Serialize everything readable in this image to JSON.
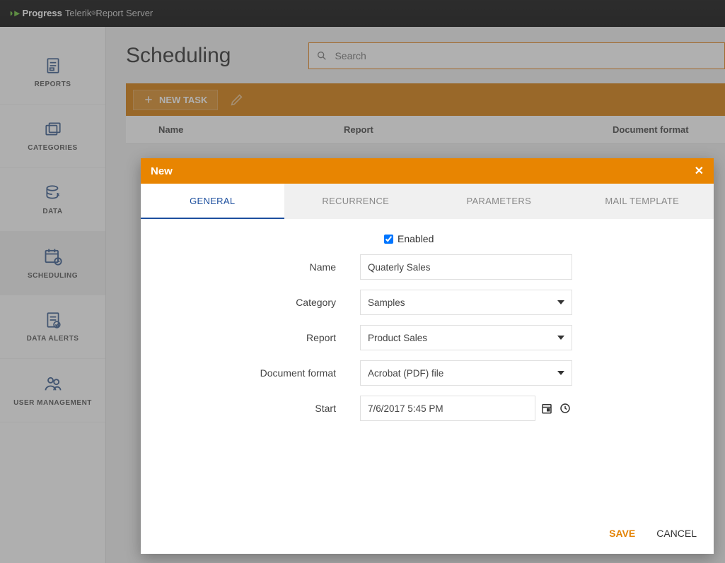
{
  "brand": {
    "prefix": "Progress",
    "product": "Telerik",
    "suffix": "Report Server"
  },
  "sidebar": {
    "items": [
      {
        "label": "REPORTS"
      },
      {
        "label": "CATEGORIES"
      },
      {
        "label": "DATA"
      },
      {
        "label": "SCHEDULING"
      },
      {
        "label": "DATA ALERTS"
      },
      {
        "label": "USER MANAGEMENT"
      }
    ]
  },
  "page": {
    "title": "Scheduling"
  },
  "search": {
    "placeholder": "Search"
  },
  "toolbar": {
    "new_task": "NEW TASK"
  },
  "table": {
    "col_name": "Name",
    "col_report": "Report",
    "col_format": "Document format"
  },
  "modal": {
    "title": "New",
    "tabs": {
      "general": "GENERAL",
      "recurrence": "RECURRENCE",
      "parameters": "PARAMETERS",
      "mail": "MAIL TEMPLATE"
    },
    "form": {
      "enabled_label": "Enabled",
      "name_label": "Name",
      "name_value": "Quaterly Sales",
      "category_label": "Category",
      "category_value": "Samples",
      "report_label": "Report",
      "report_value": "Product Sales",
      "format_label": "Document format",
      "format_value": "Acrobat (PDF) file",
      "start_label": "Start",
      "start_value": "7/6/2017 5:45 PM"
    },
    "buttons": {
      "save": "SAVE",
      "cancel": "CANCEL"
    }
  }
}
